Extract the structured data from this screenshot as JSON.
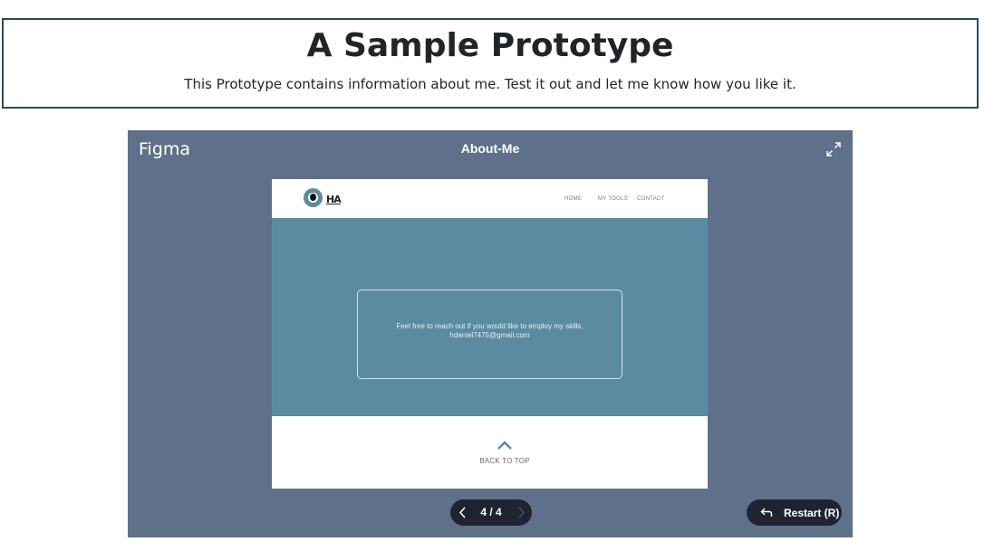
{
  "header": {
    "title": "A Sample Prototype",
    "subtitle": "This Prototype contains information about me. Test it out and let me know how you like it."
  },
  "figma": {
    "logo": "Figma",
    "frame_title": "About-Me",
    "expand_icon": "expand-icon",
    "prototype": {
      "logo_text": "HA",
      "nav": [
        "HOME",
        "MY TOOLS",
        "CONTACT"
      ],
      "card_lines": [
        "Feel free to reach out if you would like to employ my skills.",
        "hdaniel7475@gmail.com"
      ],
      "back_to_top": "BACK TO TOP",
      "colors": {
        "hero": "#5b8ba1",
        "embed_bg": "#5f718a"
      }
    },
    "pager": {
      "current": 4,
      "total": 4,
      "label": "4 / 4"
    },
    "restart_label": "Restart (R)"
  }
}
